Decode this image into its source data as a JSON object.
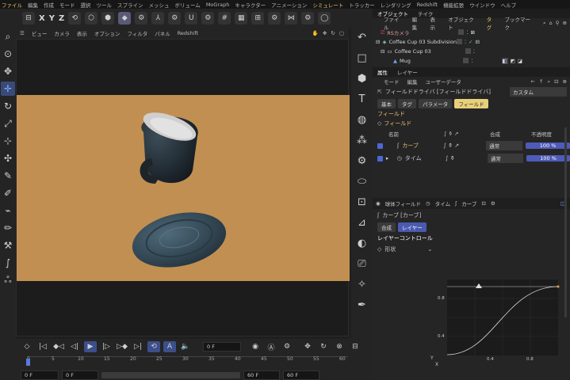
{
  "menubar": [
    "ファイル",
    "編集",
    "作成",
    "モード",
    "選択",
    "ツール",
    "スプライン",
    "メッシュ",
    "ボリューム",
    "MoGraph",
    "キャラクター",
    "アニメーション",
    "シミュレート",
    "トラッカー",
    "レンダリング",
    "Redshift",
    "機能拡張",
    "ウインドウ",
    "ヘルプ"
  ],
  "topbar": {
    "axes": [
      "X",
      "Y",
      "Z"
    ]
  },
  "viewport_menu": [
    "ビュー",
    "カメラ",
    "表示",
    "オプション",
    "フィルタ",
    "パネル",
    "Redshift"
  ],
  "timeline": {
    "current_frame": "0 F",
    "ruler": [
      "0",
      "5",
      "10",
      "15",
      "20",
      "25",
      "30",
      "35",
      "40",
      "45",
      "50",
      "55",
      "60"
    ],
    "start": "0 F",
    "start2": "0 F",
    "end": "60 F",
    "end2": "60 F"
  },
  "object_panel": {
    "tabs": [
      "オブジェクト",
      "テイク"
    ],
    "menu": [
      "ファイル",
      "編集",
      "表示",
      "オブジェクト",
      "タグ",
      "ブックマーク"
    ],
    "items": [
      "RSカメラ",
      "Coffee Cup 03 Subdivision",
      "Coffee Cup 03",
      "Mug"
    ]
  },
  "attr_panel": {
    "tabs": [
      "属性",
      "レイヤー"
    ],
    "menu": [
      "モード",
      "編集",
      "ユーザーデータ"
    ],
    "title": "フィールドドライバ [フィールドドライバ]",
    "preset": "カスタム",
    "subtabs": [
      "基本",
      "タグ",
      "パラメータ",
      "フィールド"
    ],
    "section": "フィールド",
    "group": "フィールド",
    "columns": {
      "name": "名前",
      "blend": "合成",
      "opacity": "不透明度"
    },
    "layers": [
      {
        "name": "カーブ",
        "mode": "通常",
        "opacity": "100 %"
      },
      {
        "name": "タイム",
        "mode": "通常",
        "opacity": "100 %"
      }
    ],
    "bottom_tabs": [
      "球体フィールド",
      "タイム",
      "カーブ"
    ],
    "curve_title": "カーブ [カーブ]",
    "curve_tabs": [
      "合成",
      "レイヤー"
    ],
    "layer_control": "レイヤーコントロール",
    "shape": "形状",
    "graph": {
      "y_labels": [
        "0.8",
        "0.4"
      ],
      "x_labels": [
        "0.4",
        "0.8"
      ],
      "y_axis": "Y",
      "x_axis": "X"
    }
  },
  "colors": {
    "scene": "#c18f52",
    "accent": "#4e5bb8",
    "highlight": "#e8cf7a"
  }
}
